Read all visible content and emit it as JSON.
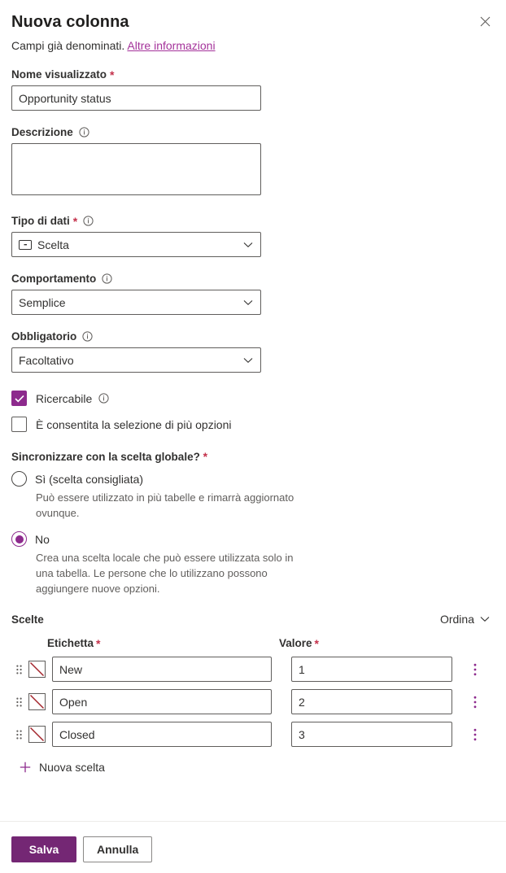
{
  "header": {
    "title": "Nuova colonna",
    "subtitle": "Campi già denominati.",
    "link": "Altre informazioni",
    "close_icon": "close-icon"
  },
  "fields": {
    "display_name": {
      "label": "Nome visualizzato",
      "required": "*",
      "value": "Opportunity status",
      "placeholder": ""
    },
    "description": {
      "label": "Descrizione",
      "value": "",
      "placeholder": ""
    },
    "data_type": {
      "label": "Tipo di dati",
      "required": "*",
      "value": "Scelta"
    },
    "behavior": {
      "label": "Comportamento",
      "value": "Semplice"
    },
    "required_level": {
      "label": "Obbligatorio",
      "value": "Facoltativo"
    }
  },
  "checkboxes": [
    {
      "label": "Ricercabile",
      "checked": true,
      "has_info": true
    },
    {
      "label": "È consentita la selezione di più opzioni",
      "checked": false,
      "has_info": false
    }
  ],
  "sync_group": {
    "label": "Sincronizzare con la scelta globale?",
    "required": "*",
    "options": [
      {
        "label": "Sì (scelta consigliata)",
        "selected": false,
        "description": "Può essere utilizzato in più tabelle e rimarrà aggiornato ovunque."
      },
      {
        "label": "No",
        "selected": true,
        "description": "Crea una scelta locale che può essere utilizzata solo in una tabella. Le persone che lo utilizzano possono aggiungere nuove opzioni."
      }
    ]
  },
  "choices": {
    "title": "Scelte",
    "sort_label": "Ordina",
    "columns": {
      "label": "Etichetta",
      "label_required": "*",
      "value": "Valore",
      "value_required": "*"
    },
    "rows": [
      {
        "label": "New",
        "value": "1",
        "color": "none"
      },
      {
        "label": "Open",
        "value": "2",
        "color": "none"
      },
      {
        "label": "Closed",
        "value": "3",
        "color": "none"
      }
    ],
    "add_label": "Nuova scelta"
  },
  "footer": {
    "save_label": "Salva",
    "cancel_label": "Annulla"
  },
  "colors": {
    "accent": "#742774",
    "accent_light": "#8d2a8d",
    "link": "#a4329a",
    "required_red": "#c4314b",
    "swatch_line": "#a4262c"
  }
}
